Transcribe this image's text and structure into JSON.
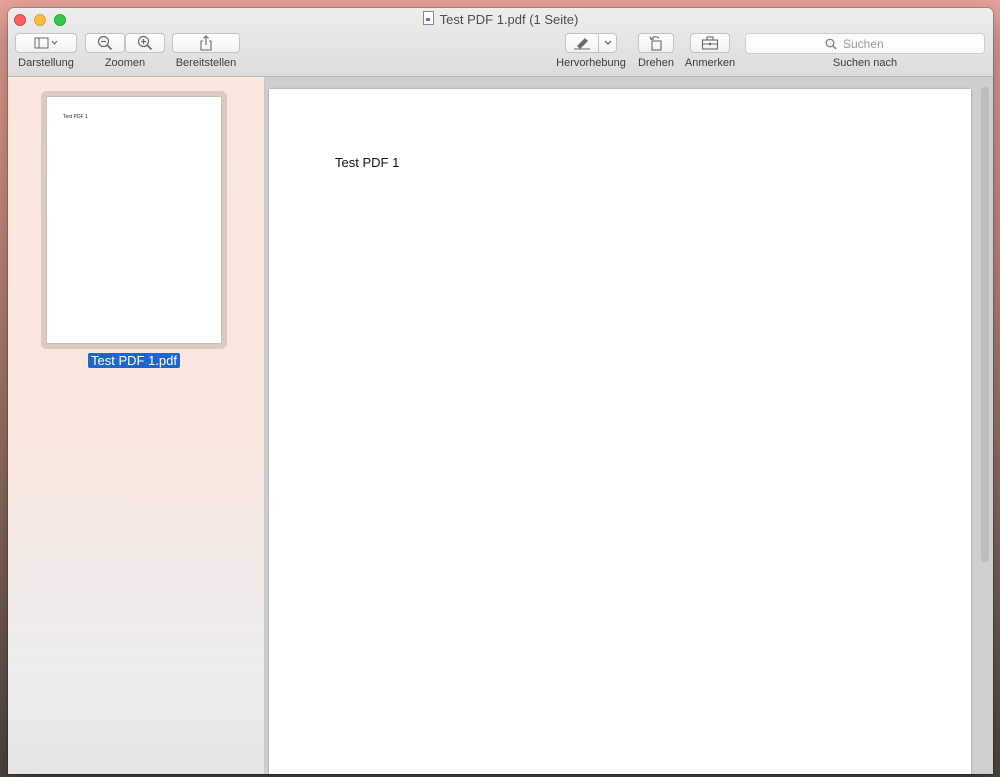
{
  "window": {
    "title": "Test PDF 1.pdf (1 Seite)"
  },
  "toolbar": {
    "view_label": "Darstellung",
    "zoom_label": "Zoomen",
    "share_label": "Bereitstellen",
    "highlight_label": "Hervorhebung",
    "rotate_label": "Drehen",
    "annotate_label": "Anmerken",
    "search_label": "Suchen nach",
    "search_placeholder": "Suchen"
  },
  "icons": {
    "view": "sidebar-icon",
    "zoom_out": "zoom-out-icon",
    "zoom_in": "zoom-in-icon",
    "share": "share-icon",
    "highlight": "highlighter-icon",
    "rotate": "rotate-left-icon",
    "annotate": "toolbox-icon",
    "search": "search-icon"
  },
  "sidebar": {
    "thumbnails": [
      {
        "label": "Test PDF 1.pdf",
        "page_text": "Test PDF 1"
      }
    ]
  },
  "document": {
    "page_text": "Test PDF 1"
  },
  "colors": {
    "selection": "#1f64cf",
    "close": "#fc605c",
    "minimize": "#fdbc40",
    "maximize": "#34c84a"
  }
}
